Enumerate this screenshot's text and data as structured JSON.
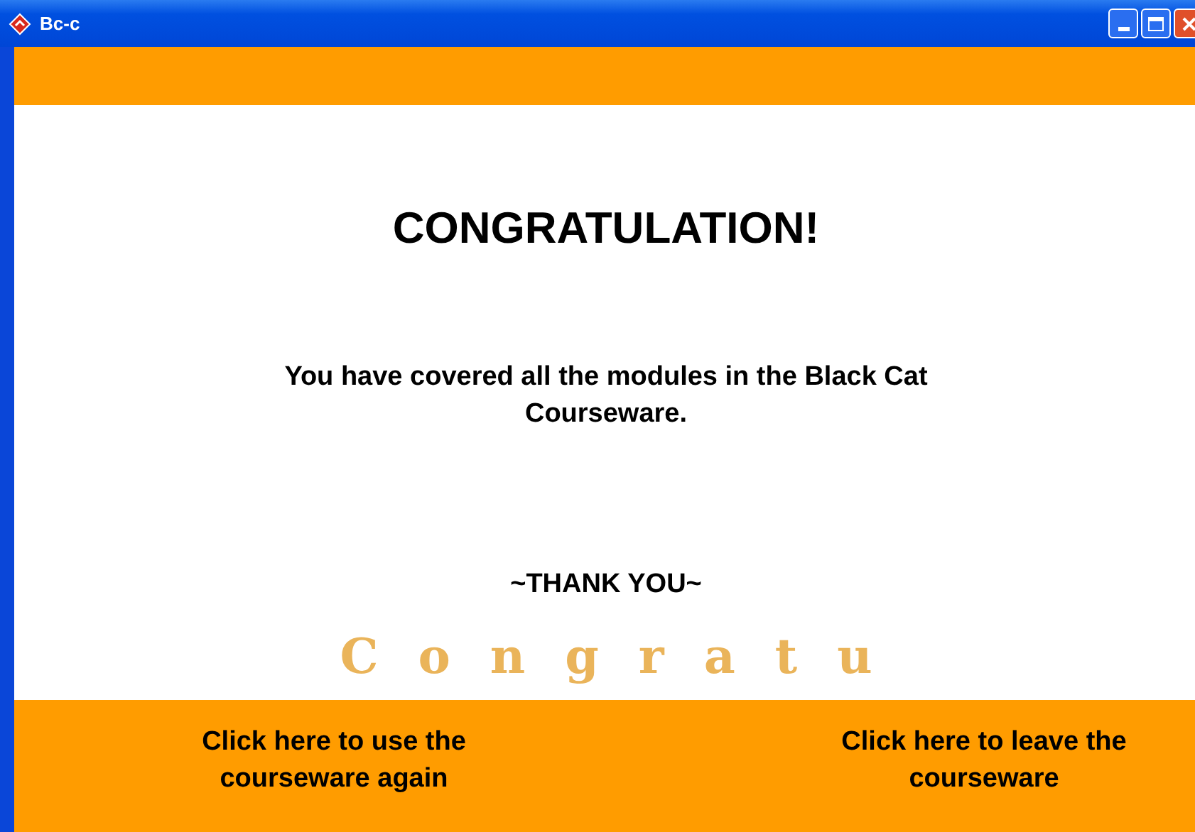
{
  "window": {
    "title": "Bc-c"
  },
  "heading": "CONGRATULATION!",
  "message": "You have covered all the modules in the Black Cat Courseware.",
  "thanks": "~THANK YOU~",
  "banner": "Congratu",
  "actions": [
    {
      "label": "Click here to use the courseware again"
    },
    {
      "label": "Click here to leave the courseware"
    }
  ]
}
